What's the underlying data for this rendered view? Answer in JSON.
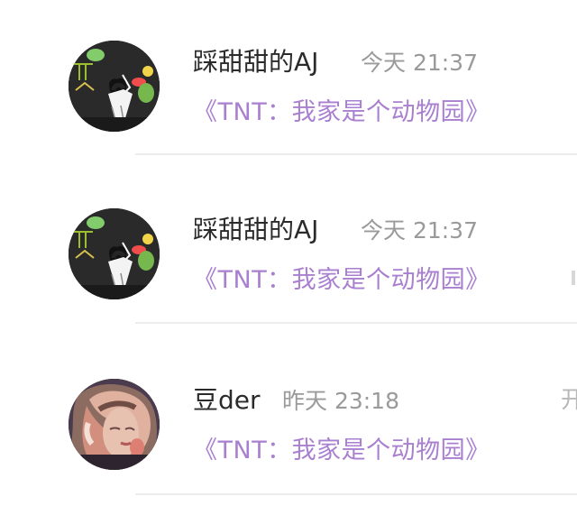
{
  "conversations": [
    {
      "sender": "踩甜甜的AJ",
      "time": "今天 21:37",
      "message": "《TNT：我家是个动物园》",
      "avatar_icon": "user-avatar-photo"
    },
    {
      "sender": "踩甜甜的AJ",
      "time": "今天 21:37",
      "message": "《TNT：我家是个动物园》",
      "avatar_icon": "user-avatar-photo"
    },
    {
      "sender": "豆der",
      "time": "昨天 23:18",
      "message": "《TNT：我家是个动物园》",
      "avatar_icon": "user-avatar-photo"
    }
  ],
  "edge_text": "开",
  "colors": {
    "name": "#2b2b2b",
    "time": "#9a9a9a",
    "message": "#a97fd0",
    "divider": "#ececec"
  }
}
